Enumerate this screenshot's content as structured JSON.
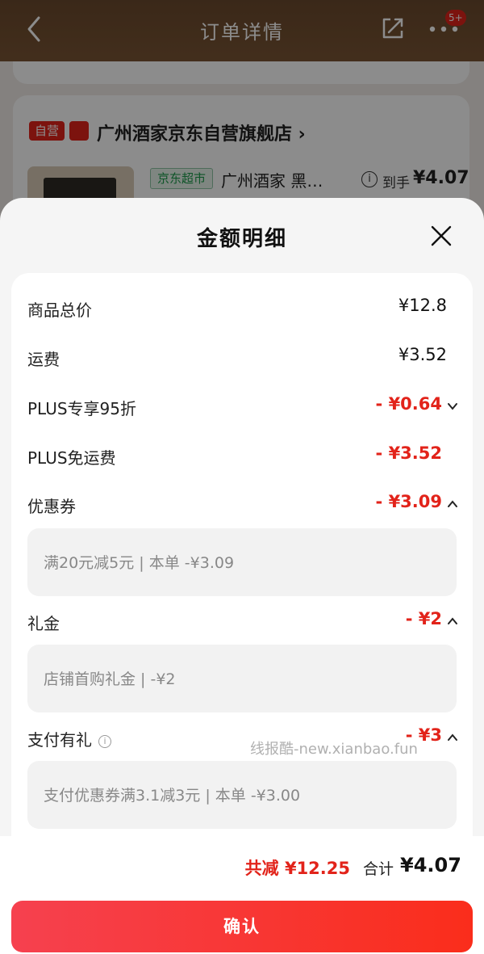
{
  "header": {
    "title": "订单详情",
    "badge": "5+"
  },
  "shop": {
    "self_tag": "自营",
    "name": "广州酒家京东自营旗舰店 ›"
  },
  "product": {
    "market_tag": "京东超市",
    "name": "广州酒家 黑…",
    "paid_label": "到手",
    "paid_value": "¥4.07"
  },
  "sheet": {
    "title": "金额明细",
    "rows": [
      {
        "label": "商品总价",
        "value": "¥12.8"
      },
      {
        "label": "运费",
        "value": "¥3.52"
      },
      {
        "label": "PLUS专享95折",
        "value": "- ¥0.64"
      },
      {
        "label": "PLUS免运费",
        "value": "- ¥3.52"
      },
      {
        "label": "优惠券",
        "value": "- ¥3.09"
      },
      {
        "label": "礼金",
        "value": "- ¥2"
      },
      {
        "label": "支付有礼",
        "value": "- ¥3"
      }
    ],
    "coupon_detail": "满20元减5元 | 本单 -¥3.09",
    "gift_detail": "店铺首购礼金 | -¥2",
    "pay_detail": "支付优惠券满3.1减3元 | 本单 -¥3.00",
    "watermark": "线报酷-new.xianbao.fun"
  },
  "total": {
    "saved": "共减 ¥12.25",
    "label": "合计",
    "value": "¥4.07"
  },
  "confirm_label": "确认",
  "colors": {
    "accent": "#e2231a",
    "brown_header": "#6b4a2e"
  }
}
